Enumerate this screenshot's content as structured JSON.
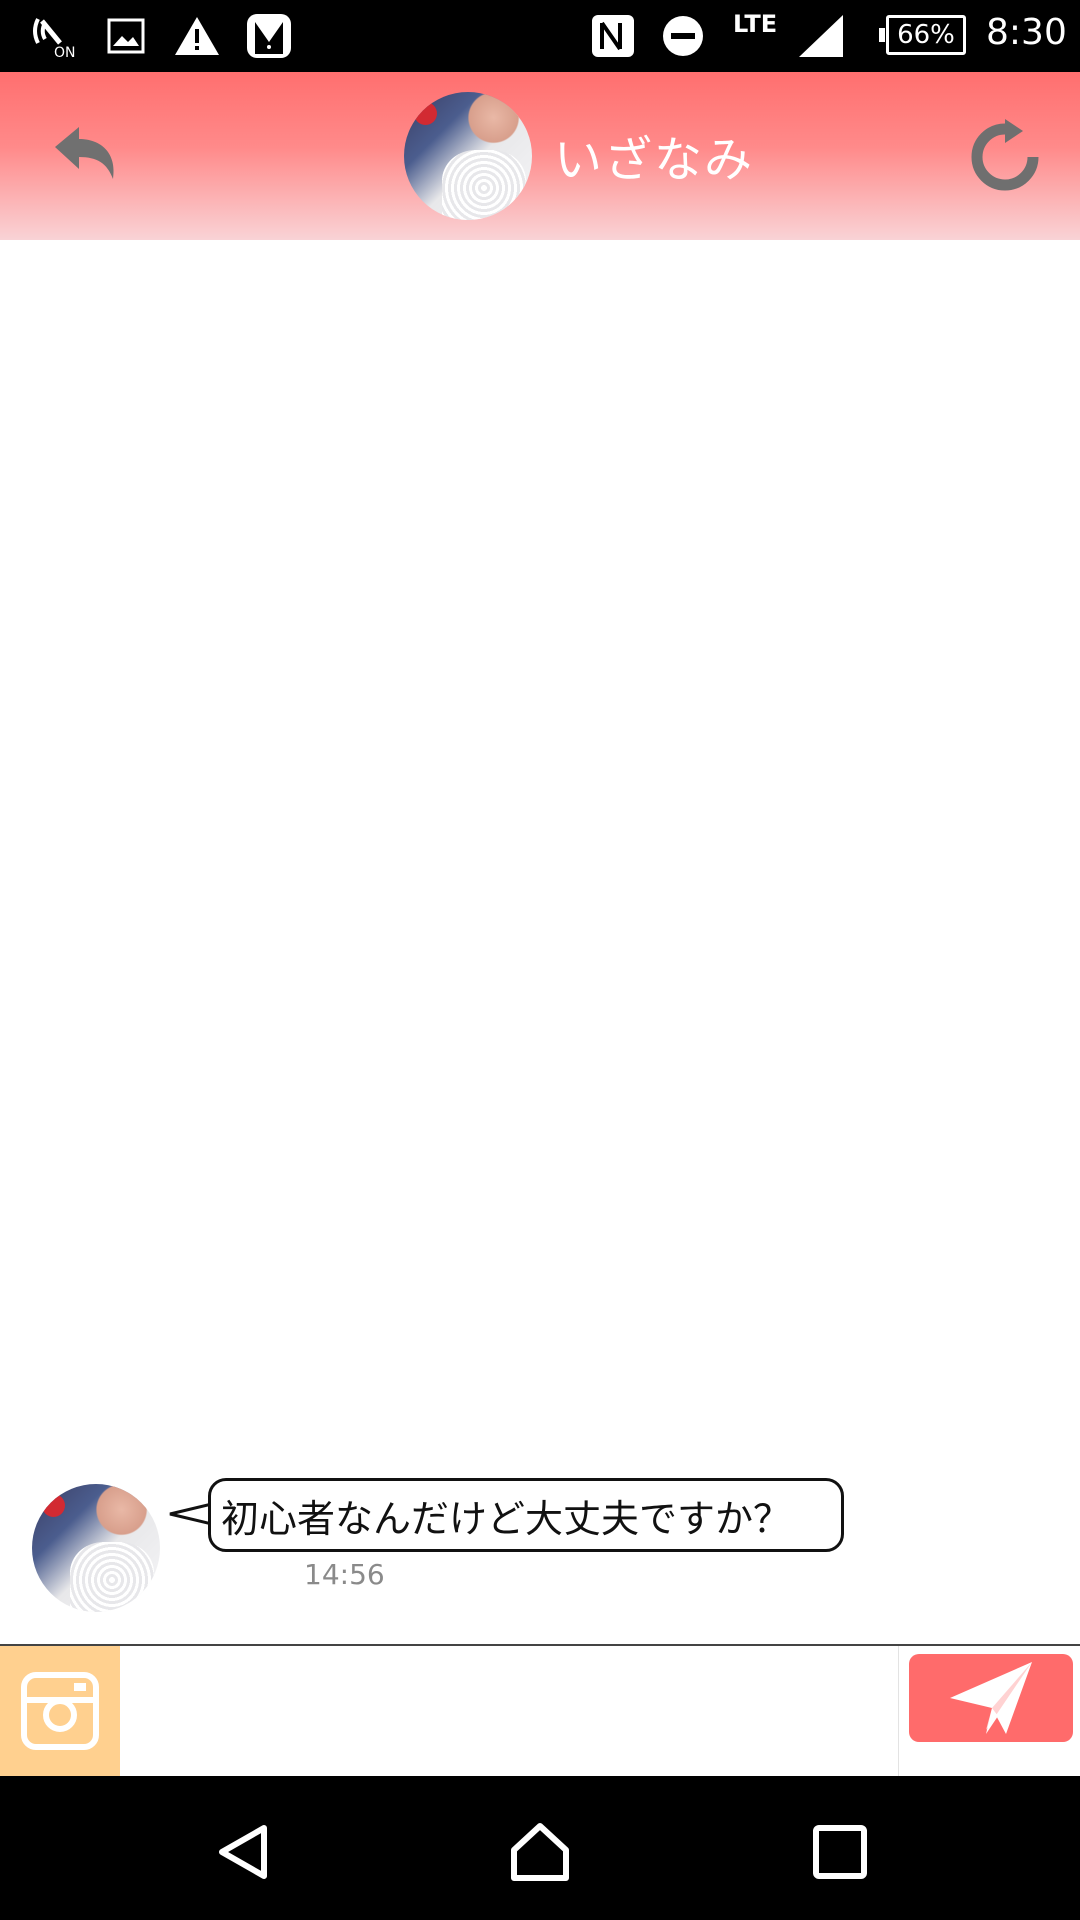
{
  "status_bar": {
    "icons": [
      "nfc-on-icon",
      "image-icon",
      "warning-icon",
      "tuxedo-app-icon",
      "nfc-icon",
      "do-not-disturb-icon",
      "signal-icon"
    ],
    "network": "LTE",
    "battery": "66%",
    "time": "8:30"
  },
  "header": {
    "name": "いざなみ",
    "icons": {
      "back": "back-arrow-icon",
      "refresh": "refresh-icon"
    }
  },
  "messages": [
    {
      "text": "初心者なんだけど大丈夫ですか？",
      "time": "14:56"
    }
  ],
  "input_bar": {
    "message_placeholder": "",
    "icons": {
      "camera": "camera-icon",
      "send": "send-icon"
    }
  },
  "colors": {
    "header_top": "#ff6f6f",
    "header_bottom": "#f9d3d6",
    "send_button": "#ff6b6b",
    "camera_button": "#ffd08f"
  },
  "nav_bar": {
    "icons": [
      "back-triangle-icon",
      "home-icon",
      "recents-icon"
    ]
  }
}
